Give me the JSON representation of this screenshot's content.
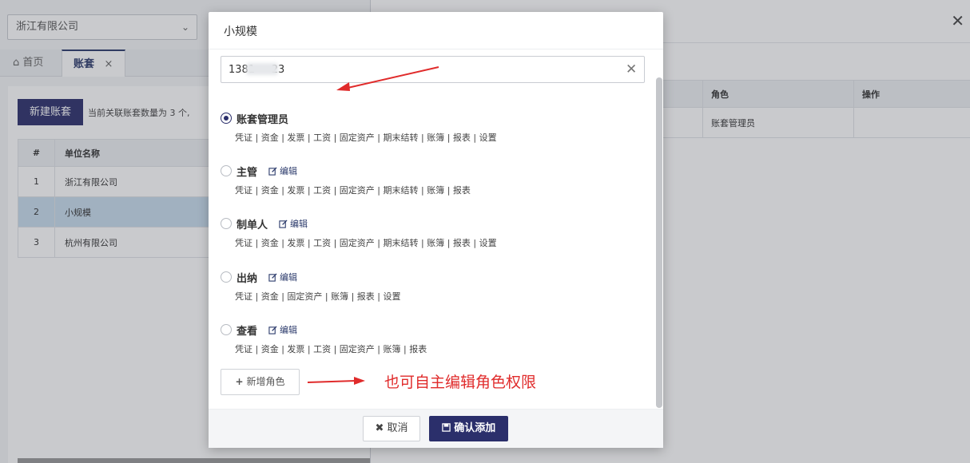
{
  "background": {
    "company_select": "浙江有限公司",
    "tabs": {
      "home": "首页",
      "active": "账套",
      "close": "×"
    },
    "new_button": "新建账套",
    "count_text": "当前关联账套数量为 3 个,",
    "left_table": {
      "headers": [
        "#",
        "单位名称"
      ],
      "rows": [
        {
          "num": "1",
          "name": "浙江有限公司"
        },
        {
          "num": "2",
          "name": "小规模"
        },
        {
          "num": "3",
          "name": "杭州有限公司"
        }
      ]
    },
    "right_table": {
      "headers": [
        "角色",
        "操作"
      ],
      "row": {
        "role": "账套管理员",
        "action": ""
      }
    },
    "close": "✕"
  },
  "modal": {
    "title": "小规模",
    "search": {
      "value": "1381     23"
    },
    "edit_label": "编辑",
    "roles": [
      {
        "name": "账套管理员",
        "selected": true,
        "editable": false,
        "perms": "凭证 | 资金 | 发票 | 工资 | 固定资产 | 期末结转 | 账簿 | 报表 | 设置"
      },
      {
        "name": "主管",
        "selected": false,
        "editable": true,
        "perms": "凭证 | 资金 | 发票 | 工资 | 固定资产 | 期末结转 | 账簿 | 报表"
      },
      {
        "name": "制单人",
        "selected": false,
        "editable": true,
        "perms": "凭证 | 资金 | 发票 | 工资 | 固定资产 | 期末结转 | 账簿 | 报表 | 设置"
      },
      {
        "name": "出纳",
        "selected": false,
        "editable": true,
        "perms": "凭证 | 资金 | 固定资产 | 账簿 | 报表 | 设置"
      },
      {
        "name": "查看",
        "selected": false,
        "editable": true,
        "perms": "凭证 | 资金 | 发票 | 工资 | 固定资产 | 账簿 | 报表"
      }
    ],
    "add_role": "新增角色",
    "annotation": "也可自主编辑角色权限",
    "cancel": "取消",
    "confirm": "确认添加"
  },
  "colors": {
    "primary": "#2b2f6b",
    "annotation": "#e02b2b",
    "selected_row": "#c8ddee"
  }
}
